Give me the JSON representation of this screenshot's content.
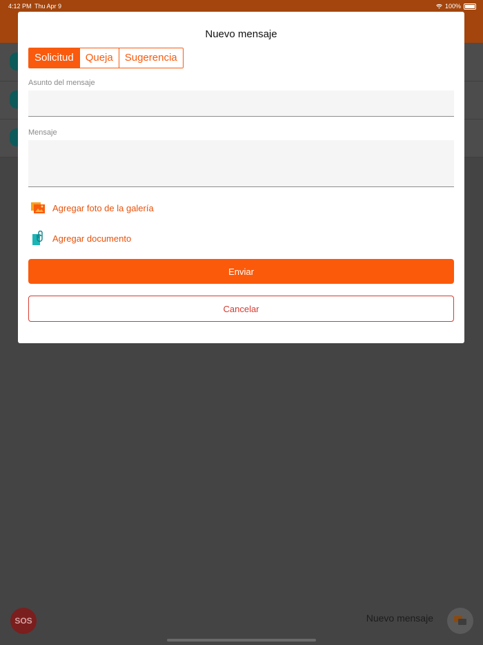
{
  "status_bar": {
    "time": "4:12 PM",
    "date": "Thu Apr 9",
    "battery": "100%"
  },
  "modal": {
    "title": "Nuevo mensaje",
    "segments": [
      {
        "label": "Solicitud",
        "selected": true
      },
      {
        "label": "Queja",
        "selected": false
      },
      {
        "label": "Sugerencia",
        "selected": false
      }
    ],
    "subject": {
      "label": "Asunto del mensaje",
      "value": ""
    },
    "message": {
      "label": "Mensaje",
      "value": ""
    },
    "add_photo_label": "Agregar foto de la galería",
    "add_document_label": "Agregar documento",
    "send_label": "Enviar",
    "cancel_label": "Cancelar"
  },
  "background": {
    "sos_label": "SOS",
    "new_message_label": "Nuevo mensaje"
  },
  "colors": {
    "accent": "#fb5a0a",
    "cancel": "#d43a30",
    "document_icon": "#1cb5b5"
  },
  "icons": [
    "wifi-icon",
    "battery-icon",
    "gallery-photo-icon",
    "document-clip-icon",
    "chat-bubbles-icon",
    "avatar-icon"
  ]
}
